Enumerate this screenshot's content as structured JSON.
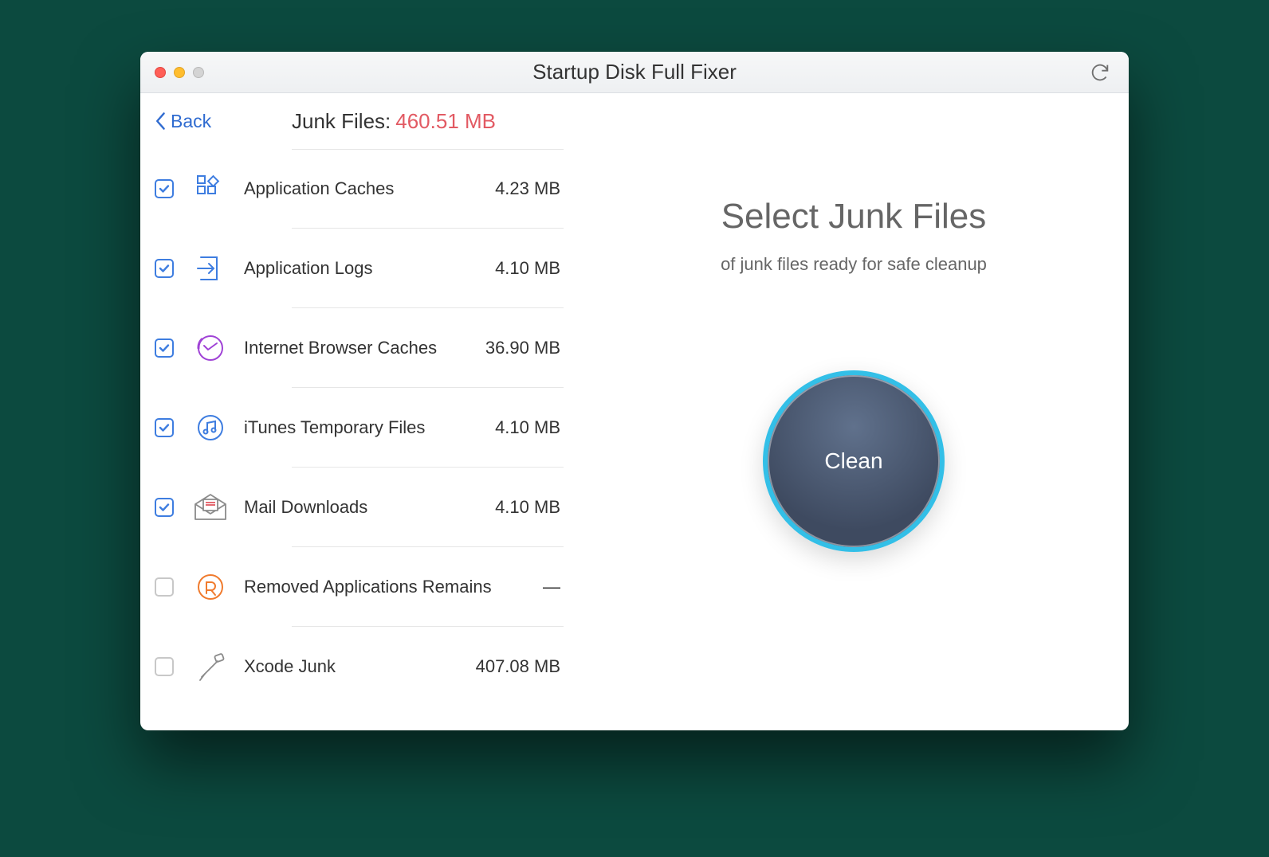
{
  "window": {
    "title_prefix": "Startup Disk Full",
    "title_bold": "Fixer"
  },
  "sidebar": {
    "back_label": "Back",
    "junk_label": "Junk Files:",
    "junk_size": "460.51 MB",
    "items": [
      {
        "label": "Application Caches",
        "size": "4.23 MB",
        "checked": true,
        "icon": "app-caches-icon"
      },
      {
        "label": "Application Logs",
        "size": "4.10 MB",
        "checked": true,
        "icon": "app-logs-icon"
      },
      {
        "label": "Internet Browser Caches",
        "size": "36.90 MB",
        "checked": true,
        "icon": "browser-caches-icon"
      },
      {
        "label": "iTunes Temporary Files",
        "size": "4.10 MB",
        "checked": true,
        "icon": "itunes-temp-icon"
      },
      {
        "label": "Mail Downloads",
        "size": "4.10 MB",
        "checked": true,
        "icon": "mail-downloads-icon"
      },
      {
        "label": "Removed Applications Remains",
        "size": "—",
        "checked": false,
        "icon": "removed-apps-icon"
      },
      {
        "label": "Xcode Junk",
        "size": "407.08 MB",
        "checked": false,
        "icon": "xcode-junk-icon"
      }
    ]
  },
  "main": {
    "title": "Select Junk Files",
    "subtitle": "of junk files ready for safe cleanup",
    "clean_label": "Clean"
  }
}
